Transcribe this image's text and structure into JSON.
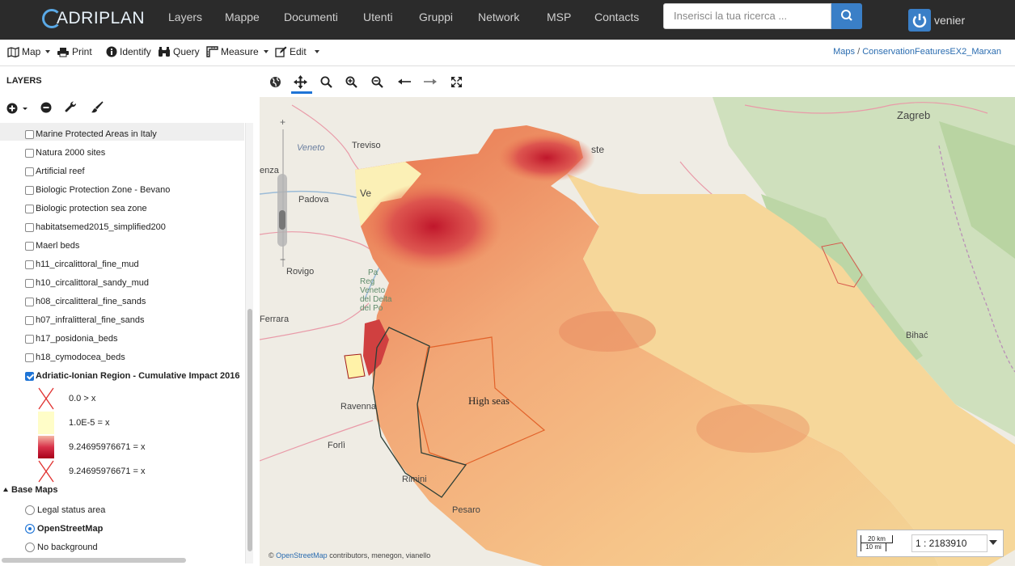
{
  "brand": {
    "logo_text": "ADRIPLAN"
  },
  "nav": {
    "items": [
      "Layers",
      "Mappe",
      "Documenti",
      "Utenti",
      "Gruppi",
      "Network",
      "MSP",
      "Contacts"
    ]
  },
  "search": {
    "placeholder": "Inserisci la tua ricerca ..."
  },
  "user": {
    "name": "venier"
  },
  "toolbar": {
    "map_label": "Map",
    "print_label": "Print",
    "identify_label": "Identify",
    "query_label": "Query",
    "measure_label": "Measure",
    "edit_label": "Edit"
  },
  "breadcrumb": {
    "root": "Maps",
    "separator": "/",
    "current": "ConservationFeaturesEX2_Marxan"
  },
  "panel": {
    "title": "LAYERS",
    "layers": [
      {
        "label": "Marine Protected Areas in Italy",
        "checked": false
      },
      {
        "label": "Natura 2000 sites",
        "checked": false
      },
      {
        "label": "Artificial reef",
        "checked": false
      },
      {
        "label": "Biologic Protection Zone - Bevano",
        "checked": false
      },
      {
        "label": "Biologic protection sea zone",
        "checked": false
      },
      {
        "label": "habitatsemed2015_simplified200",
        "checked": false
      },
      {
        "label": "Maerl beds",
        "checked": false
      },
      {
        "label": "h11_circalittoral_fine_mud",
        "checked": false
      },
      {
        "label": "h10_circalittoral_sandy_mud",
        "checked": false
      },
      {
        "label": "h08_circalitteral_fine_sands",
        "checked": false
      },
      {
        "label": "h07_infralitteral_fine_sands",
        "checked": false
      },
      {
        "label": "h17_posidonia_beds",
        "checked": false
      },
      {
        "label": "h18_cymodocea_beds",
        "checked": false
      },
      {
        "label": "Adriatic-Ionian Region - Cumulative Impact 2016",
        "checked": true
      }
    ],
    "legend": [
      {
        "text": "0.0  >  x"
      },
      {
        "text": "1.0E-5  =  x"
      },
      {
        "text": "9.24695976671  =  x"
      },
      {
        "text": "9.24695976671  =  x"
      }
    ],
    "base_maps_title": "Base Maps",
    "base_maps": [
      {
        "label": "Legal status area",
        "selected": false
      },
      {
        "label": "OpenStreetMap",
        "selected": true
      },
      {
        "label": "No background",
        "selected": false
      }
    ]
  },
  "map": {
    "places": [
      "Zagreb",
      "Treviso",
      "Veneto",
      "Padova",
      "Rovigo",
      "Ferrara",
      "Ravenna",
      "Forlì",
      "Rimini",
      "Pesaro",
      "Bihać",
      "ste",
      "enza",
      "Ve"
    ],
    "park_label": [
      "Pa",
      "Reg",
      "Veneto",
      "del Delta",
      "del Po"
    ],
    "high_seas": "High seas",
    "attribution_link": "OpenStreetMap",
    "attribution_prefix": "©",
    "attribution_suffix": "contributors, menegon, vianello",
    "scale_km": "20 km",
    "scale_mi": "10 mi",
    "scale_value": "1 : 2183910"
  }
}
